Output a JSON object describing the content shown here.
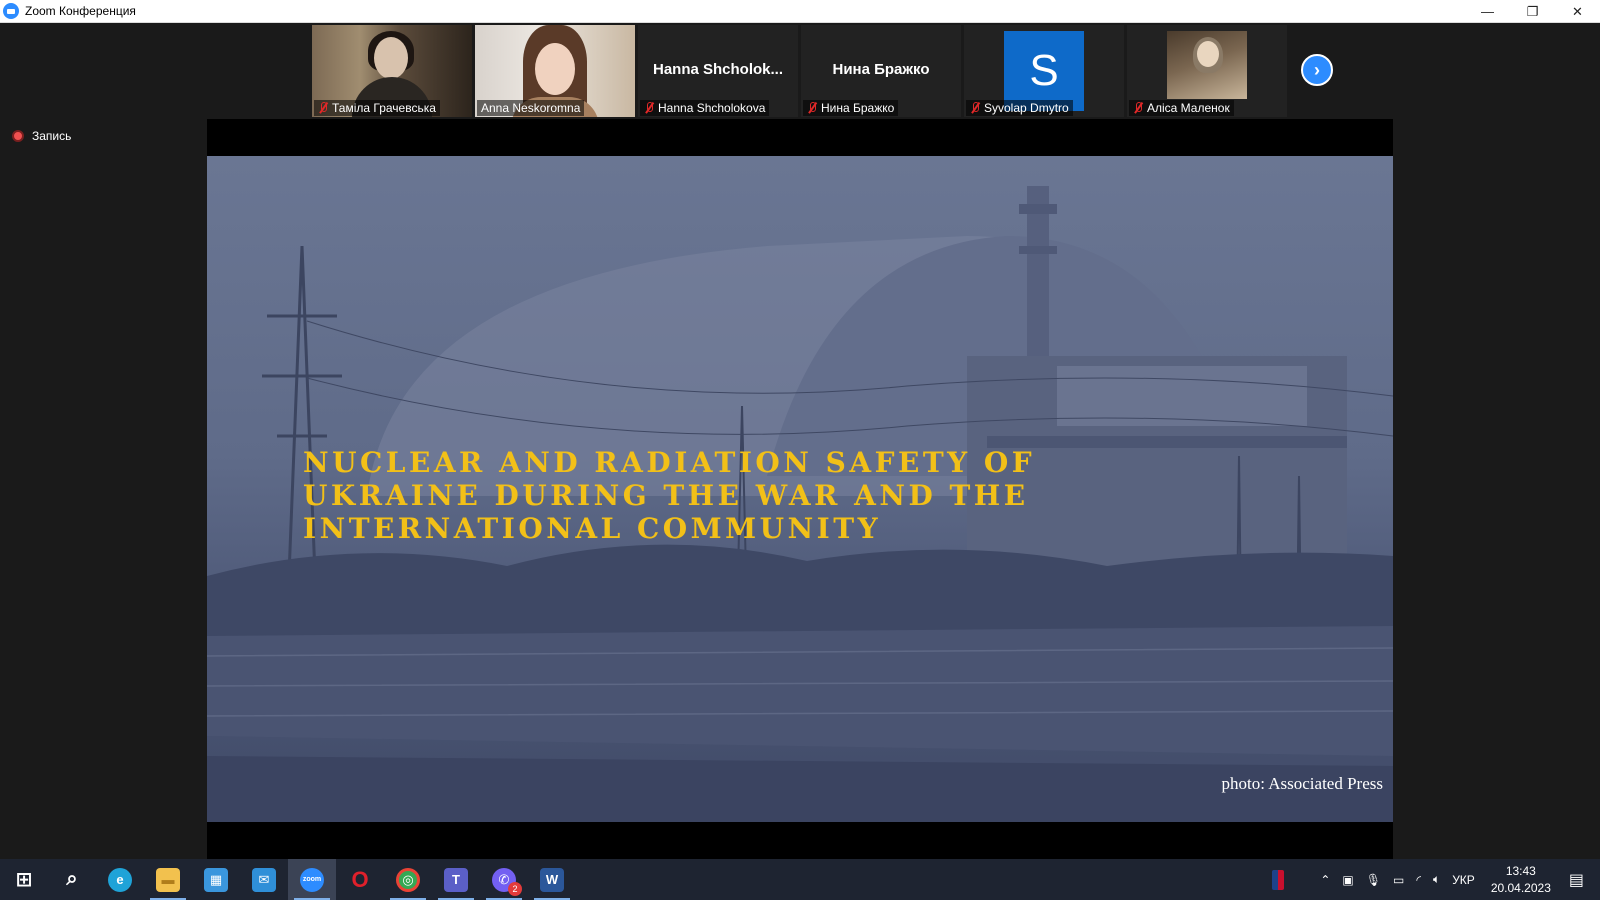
{
  "window": {
    "title": "Zoom Конференция",
    "minimize": "—",
    "restore": "❐",
    "close": "✕"
  },
  "participants": [
    {
      "name": "Таміла Грачевська",
      "muted": true,
      "video": "photo"
    },
    {
      "name": "Anna Neskoromna",
      "muted": false,
      "video": "photo",
      "active_speaker": true
    },
    {
      "name": "Hanna Shcholokova",
      "display_name": "Hanna  Shcholok...",
      "muted": true,
      "video": "off"
    },
    {
      "name": "Нина Бражко",
      "display_name": "Нина Бражко",
      "muted": true,
      "video": "off"
    },
    {
      "name": "Syvolap Dmytro",
      "avatar_letter": "S",
      "muted": true,
      "video": "avatar"
    },
    {
      "name": "Аліса Маленок",
      "muted": true,
      "video": "profile-photo"
    }
  ],
  "strip": {
    "next_icon": "›"
  },
  "recording": {
    "label": "Запись"
  },
  "slide": {
    "title_lines": [
      "NUCLEAR AND RADIATION SAFETY OF",
      "UKRAINE DURING THE WAR AND THE",
      "INTERNATIONAL COMMUNITY"
    ],
    "credit": "photo: Associated Press"
  },
  "taskbar": {
    "apps": [
      {
        "name": "start",
        "glyph": "⊞",
        "color": "#ffffff"
      },
      {
        "name": "search",
        "glyph": "⌕",
        "color": "#ffffff"
      },
      {
        "name": "edge",
        "glyph": "e",
        "color": "#1fa3d8"
      },
      {
        "name": "file-explorer",
        "glyph": "▬",
        "color": "#f2c14e"
      },
      {
        "name": "store",
        "glyph": "▦",
        "color": "#3a96dd"
      },
      {
        "name": "mail",
        "glyph": "✉",
        "color": "#2f8fd8"
      },
      {
        "name": "zoom",
        "glyph": "zoom",
        "color": "#2d8cff"
      },
      {
        "name": "opera",
        "glyph": "O",
        "color": "#e0202b"
      },
      {
        "name": "chrome",
        "glyph": "◎",
        "color": "#34a853"
      },
      {
        "name": "teams",
        "glyph": "T",
        "color": "#5b5fc7"
      },
      {
        "name": "viber",
        "glyph": "✆",
        "color": "#7360f2",
        "badge": "2"
      },
      {
        "name": "word",
        "glyph": "W",
        "color": "#2b579a"
      }
    ],
    "tray": {
      "language": "УКР",
      "time": "13:43",
      "date": "20.04.2023"
    }
  }
}
